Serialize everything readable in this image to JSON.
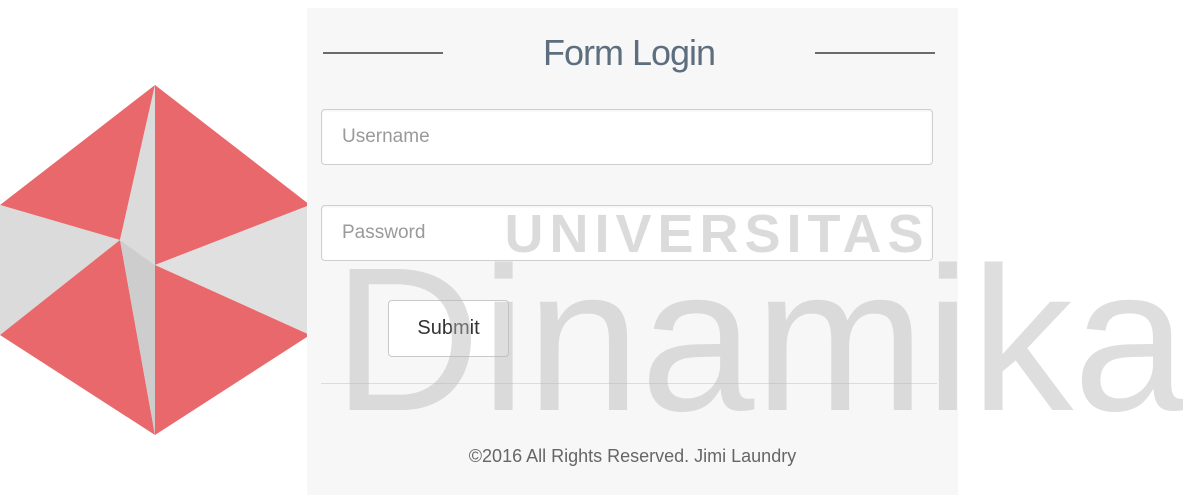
{
  "form": {
    "title": "Form Login",
    "username_placeholder": "Username",
    "password_placeholder": "Password",
    "submit_label": "Submit",
    "footer": "©2016 All Rights Reserved. Jimi Laundry"
  },
  "watermark": {
    "top_text": "UNIVERSITAS",
    "main_text": "Dinamika",
    "brand_red": "#e2363a",
    "brand_grey": "#c8c8c8"
  }
}
